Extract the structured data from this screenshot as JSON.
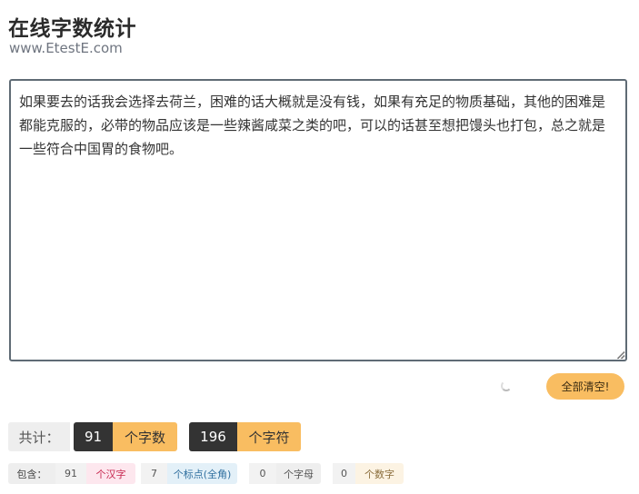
{
  "header": {
    "title": "在线字数统计",
    "site": "www.EtestE.com"
  },
  "editor": {
    "text": "如果要去的话我会选择去荷兰，困难的话大概就是没有钱，如果有充足的物质基础，其他的困难是都能克服的，必带的物品应该是一些辣酱咸菜之类的吧，可以的话甚至想把馒头也打包，总之就是一些符合中国胃的食物吧。"
  },
  "actions": {
    "clear_label": "全部清空!"
  },
  "stats": {
    "total_label": "共计：",
    "char_count": "91",
    "char_unit": "个字数",
    "symbol_count": "196",
    "symbol_unit": "个字符"
  },
  "details": {
    "label": "包含：",
    "hanzi_count": "91",
    "hanzi_unit": "个汉字",
    "punct_count": "7",
    "punct_unit": "个标点(全角)",
    "letter_count": "0",
    "letter_unit": "个字母",
    "digit_count": "0",
    "digit_unit": "个数字"
  },
  "colors": {
    "accent": "#f9bd61",
    "dark": "#333333",
    "hanzi_bg": "#fde7ee",
    "hanzi_fg": "#c7254e",
    "punct_bg": "#e3f0f8",
    "punct_fg": "#2f6f9f",
    "letter_bg": "#eeeeee",
    "letter_fg": "#555555",
    "digit_bg": "#fcf3e3",
    "digit_fg": "#8a6d3b"
  }
}
